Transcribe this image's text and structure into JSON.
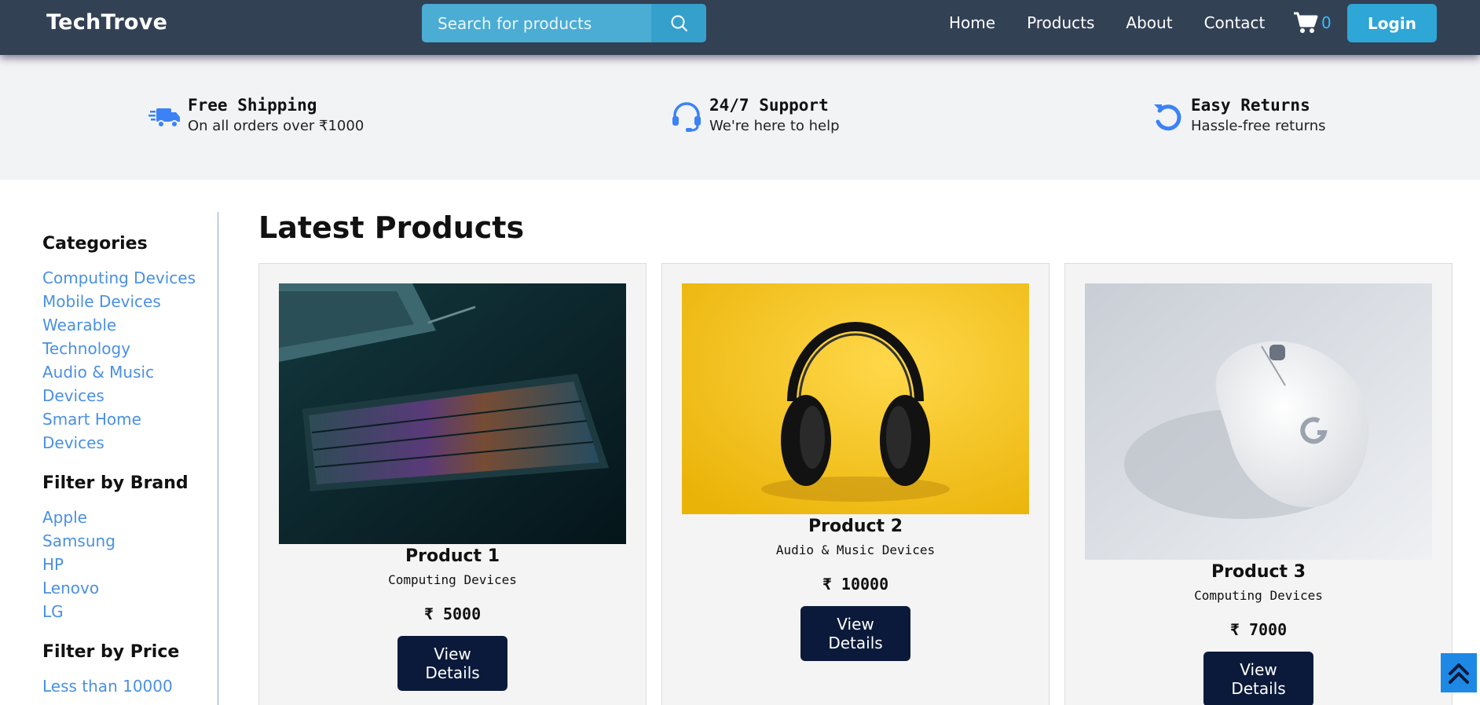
{
  "brand": "TechTrove",
  "search": {
    "placeholder": "Search for products",
    "icon": "search-icon"
  },
  "nav": {
    "links": [
      "Home",
      "Products",
      "About",
      "Contact"
    ],
    "cart_count": "0",
    "login_label": "Login"
  },
  "features": [
    {
      "icon": "shipping-truck-icon",
      "title": "Free Shipping",
      "subtitle": "On all orders over ₹1000"
    },
    {
      "icon": "headset-icon",
      "title": "24/7 Support",
      "subtitle": "We're here to help"
    },
    {
      "icon": "undo-icon",
      "title": "Easy Returns",
      "subtitle": "Hassle-free returns"
    }
  ],
  "sidebar": {
    "categories_heading": "Categories",
    "categories": [
      "Computing Devices",
      "Mobile Devices",
      "Wearable Technology",
      "Audio & Music Devices",
      "Smart Home Devices"
    ],
    "brand_heading": "Filter by Brand",
    "brands": [
      "Apple",
      "Samsung",
      "HP",
      "Lenovo",
      "LG"
    ],
    "price_heading": "Filter by Price",
    "prices": [
      "Less than 10000"
    ]
  },
  "main": {
    "title": "Latest Products",
    "products": [
      {
        "name": "Product 1",
        "category": "Computing Devices",
        "price": "₹ 5000",
        "button": "View Details",
        "image": "keyboard"
      },
      {
        "name": "Product 2",
        "category": "Audio & Music Devices",
        "price": "₹ 10000",
        "button": "View Details",
        "image": "headphones"
      },
      {
        "name": "Product 3",
        "category": "Computing Devices",
        "price": "₹ 7000",
        "button": "View Details",
        "image": "mouse"
      }
    ]
  },
  "colors": {
    "navbar": "#334155",
    "accent": "#2ea6d6",
    "link": "#4a90e2",
    "button_dark": "#0b1a3a"
  }
}
